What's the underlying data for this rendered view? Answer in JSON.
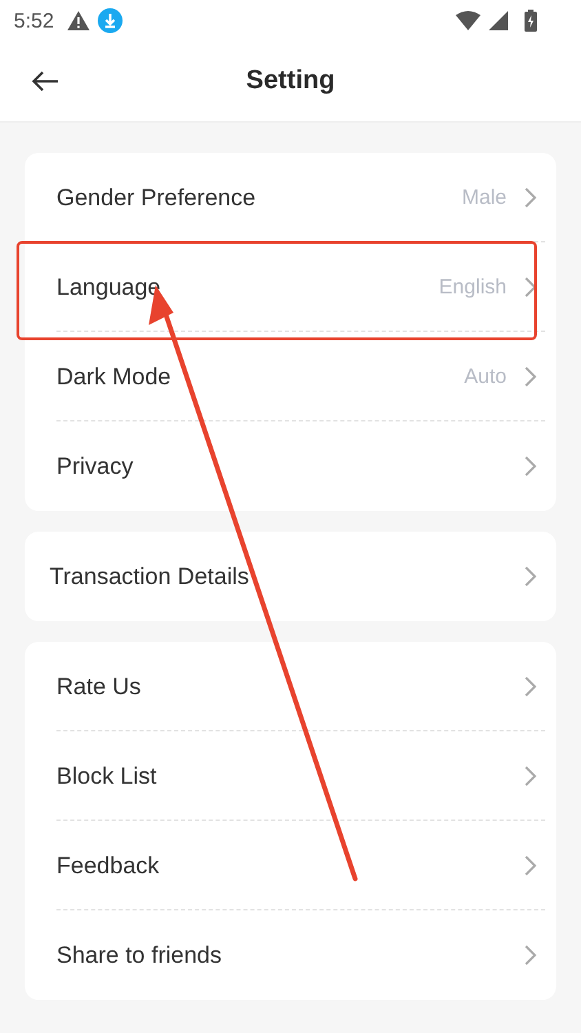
{
  "status_bar": {
    "time": "5:52"
  },
  "header": {
    "title": "Setting"
  },
  "groups": [
    {
      "items": [
        {
          "label": "Gender Preference",
          "value": "Male",
          "highlighted": false
        },
        {
          "label": "Language",
          "value": "English",
          "highlighted": true
        },
        {
          "label": "Dark Mode",
          "value": "Auto",
          "highlighted": false
        },
        {
          "label": "Privacy",
          "highlighted": false
        }
      ]
    },
    {
      "items": [
        {
          "label": "Transaction Details",
          "highlighted": false
        }
      ]
    },
    {
      "items": [
        {
          "label": "Rate Us",
          "highlighted": false
        },
        {
          "label": "Block List",
          "highlighted": false
        },
        {
          "label": "Feedback",
          "highlighted": false
        },
        {
          "label": "Share to friends",
          "highlighted": false
        }
      ]
    }
  ],
  "annotation_arrow": true
}
